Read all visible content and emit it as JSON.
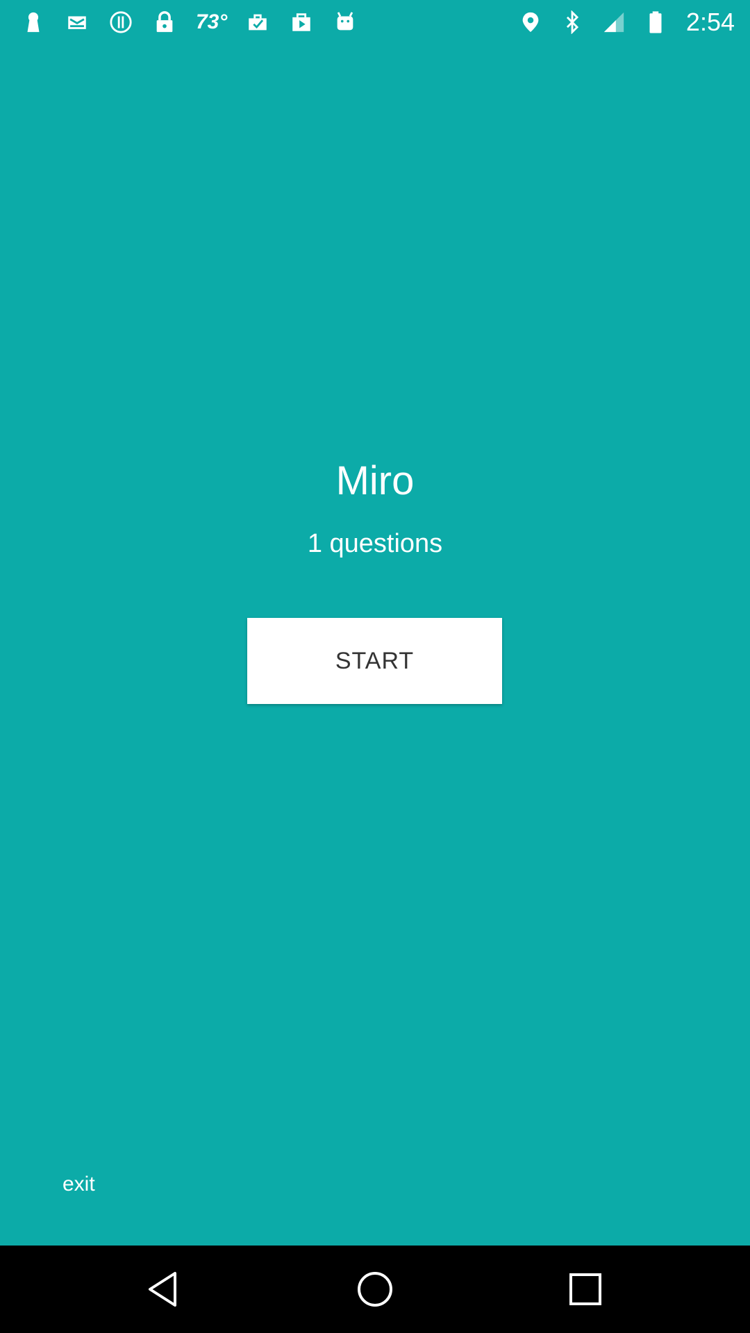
{
  "status_bar": {
    "left_icons": [
      "keyhole-icon",
      "mail-icon",
      "info-circle-icon",
      "lock-icon"
    ],
    "temperature": "73°",
    "more_left_icons": [
      "work-check-icon",
      "play-bag-icon",
      "android-icon"
    ],
    "right_icons": [
      "location-icon",
      "bluetooth-icon",
      "signal-icon",
      "battery-icon"
    ],
    "time": "2:54"
  },
  "main": {
    "title": "Miro",
    "question_count": "1 questions",
    "start_label": "START",
    "exit_label": "exit"
  },
  "nav": {
    "icons": [
      "back-icon",
      "home-icon",
      "recents-icon"
    ]
  },
  "colors": {
    "background": "#0CABA8",
    "button_bg": "#FFFFFF",
    "button_text": "#333333",
    "nav_bg": "#000000"
  }
}
